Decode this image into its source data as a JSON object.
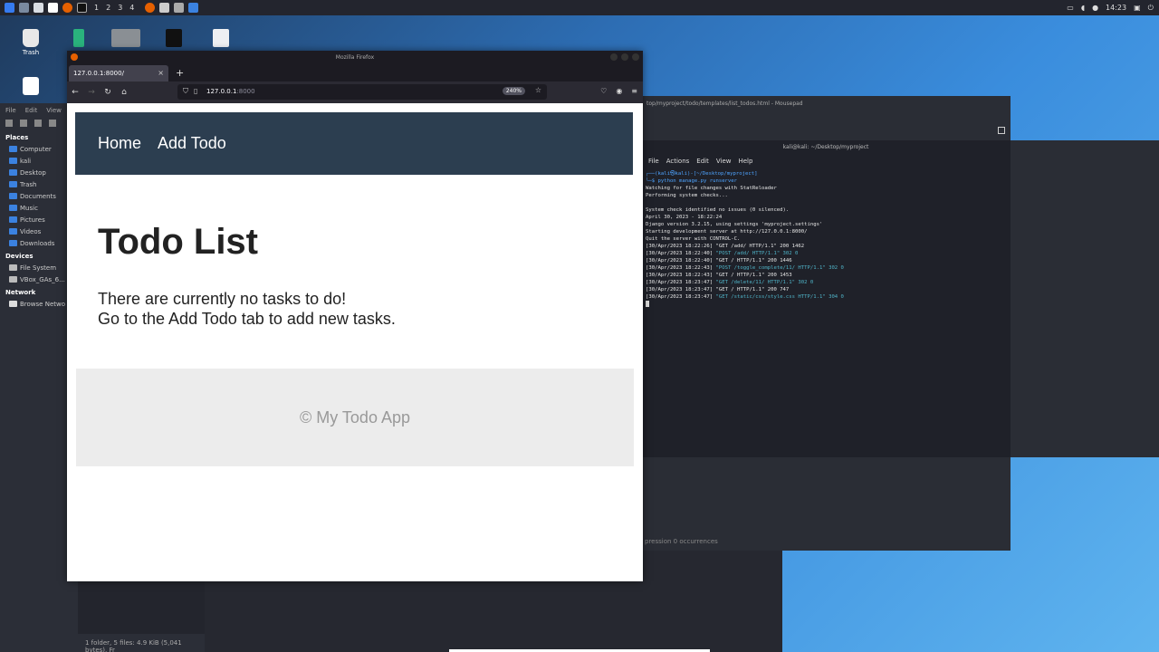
{
  "top_panel": {
    "workspaces": [
      "1",
      "2",
      "3",
      "4"
    ],
    "time": "14:23"
  },
  "desktop_icons": [
    {
      "label": "Trash",
      "icon": "trash-icon"
    },
    {
      "label": "",
      "icon": "editor-icon"
    },
    {
      "label": "",
      "icon": "image-icon"
    },
    {
      "label": "",
      "icon": "cpp-file-icon"
    },
    {
      "label": "",
      "icon": "text-file-icon"
    }
  ],
  "file_manager": {
    "menu": [
      "File",
      "Edit",
      "View"
    ],
    "places_header": "Places",
    "places": [
      "Computer",
      "kali",
      "Desktop",
      "Trash",
      "Documents",
      "Music",
      "Pictures",
      "Videos",
      "Downloads"
    ],
    "devices_header": "Devices",
    "devices": [
      "File System",
      "VBox_GAs_6..."
    ],
    "network_header": "Network",
    "network": [
      "Browse Netwo"
    ],
    "status": "1 folder, 5 files: 4.9 KiB (5,041 bytes), Fr"
  },
  "editor": {
    "title": "top/myproject/todo/templates/list_todos.html - Mousepad",
    "status": "pression   0 occurrences"
  },
  "terminal": {
    "title": "kali@kali: ~/Desktop/myproject",
    "menu": [
      "File",
      "Actions",
      "Edit",
      "View",
      "Help"
    ],
    "prompt": "┌──(kali㉿kali)-[~/Desktop/myproject]",
    "command": "└─$ python manage.py runserver",
    "lines": [
      "Watching for file changes with StatReloader",
      "Performing system checks...",
      "",
      "System check identified no issues (0 silenced).",
      "April 30, 2023 - 18:22:24",
      "Django version 3.2.15, using settings 'myproject.settings'",
      "Starting development server at http://127.0.0.1:8000/",
      "Quit the server with CONTROL-C."
    ],
    "log": [
      {
        "ts": "[30/Apr/2023 18:22:26]",
        "req": "\"GET /add/ HTTP/1.1\" 200 1462",
        "hl": false
      },
      {
        "ts": "[30/Apr/2023 18:22:40]",
        "req": "\"POST /add/ HTTP/1.1\" 302 0",
        "hl": true
      },
      {
        "ts": "[30/Apr/2023 18:22:40]",
        "req": "\"GET / HTTP/1.1\" 200 1446",
        "hl": false
      },
      {
        "ts": "[30/Apr/2023 18:22:43]",
        "req": "\"POST /toggle_complete/11/ HTTP/1.1\" 302 0",
        "hl": true
      },
      {
        "ts": "[30/Apr/2023 18:22:43]",
        "req": "\"GET / HTTP/1.1\" 200 1453",
        "hl": false
      },
      {
        "ts": "[30/Apr/2023 18:23:47]",
        "req": "\"GET /delete/11/ HTTP/1.1\" 302 0",
        "hl": true
      },
      {
        "ts": "[30/Apr/2023 18:23:47]",
        "req": "\"GET / HTTP/1.1\" 200 747",
        "hl": false
      },
      {
        "ts": "[30/Apr/2023 18:23:47]",
        "req": "\"GET /static/css/style.css HTTP/1.1\" 304 0",
        "hl": true
      }
    ]
  },
  "browser": {
    "window_title": "Mozilla Firefox",
    "tab_title": "127.0.0.1:8000/",
    "tab_close": "×",
    "new_tab": "+",
    "url_host": "127.0.0.1",
    "url_port": ":8000",
    "zoom": "240%"
  },
  "page": {
    "nav": [
      "Home",
      "Add Todo"
    ],
    "title": "Todo List",
    "message_line1": "There are currently no tasks to do!",
    "message_line2": "Go to the Add Todo tab to add new tasks.",
    "footer": "© My Todo App"
  }
}
